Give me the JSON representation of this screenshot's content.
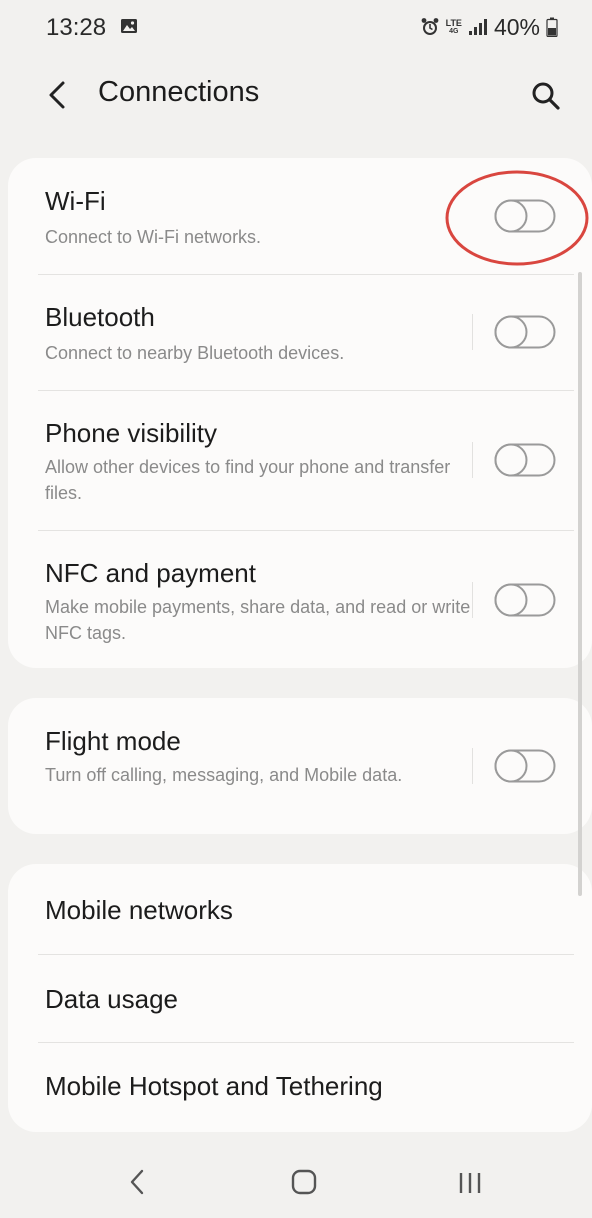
{
  "status_bar": {
    "time": "13:28",
    "gallery_icon": "gallery-icon",
    "alarm_icon": "alarm-icon",
    "network_top": "LTE",
    "network_bottom": "4G",
    "signal_icon": "signal-icon",
    "battery_percent": "40%",
    "battery_icon": "battery-icon"
  },
  "app_bar": {
    "back_icon": "back-arrow-icon",
    "title": "Connections",
    "search_icon": "search-icon"
  },
  "groups": [
    {
      "rows": [
        {
          "id": "wifi",
          "title": "Wi-Fi",
          "subtitle": "Connect to Wi-Fi networks.",
          "toggle_on": false,
          "highlighted": true
        },
        {
          "id": "bluetooth",
          "title": "Bluetooth",
          "subtitle": "Connect to nearby Bluetooth devices.",
          "toggle_on": false
        },
        {
          "id": "phone-visibility",
          "title": "Phone visibility",
          "subtitle": "Allow other devices to find your phone and transfer files.",
          "toggle_on": false
        },
        {
          "id": "nfc",
          "title": "NFC and payment",
          "subtitle": "Make mobile payments, share data, and read or write NFC tags.",
          "toggle_on": false
        }
      ]
    },
    {
      "rows": [
        {
          "id": "flight-mode",
          "title": "Flight mode",
          "subtitle": "Turn off calling, messaging, and Mobile data.",
          "toggle_on": false
        }
      ]
    },
    {
      "rows": [
        {
          "id": "mobile-networks",
          "title": "Mobile networks"
        },
        {
          "id": "data-usage",
          "title": "Data usage"
        },
        {
          "id": "hotspot",
          "title": "Mobile Hotspot and Tethering"
        }
      ]
    }
  ],
  "colors": {
    "background": "#f2f1ef",
    "card": "#fcfbfa",
    "toggle_outline": "#9a9a9a",
    "highlight_ring": "#d9463f"
  },
  "nav_bar": {
    "back_icon": "nav-back-icon",
    "home_icon": "nav-home-icon",
    "recents_icon": "nav-recents-icon"
  }
}
